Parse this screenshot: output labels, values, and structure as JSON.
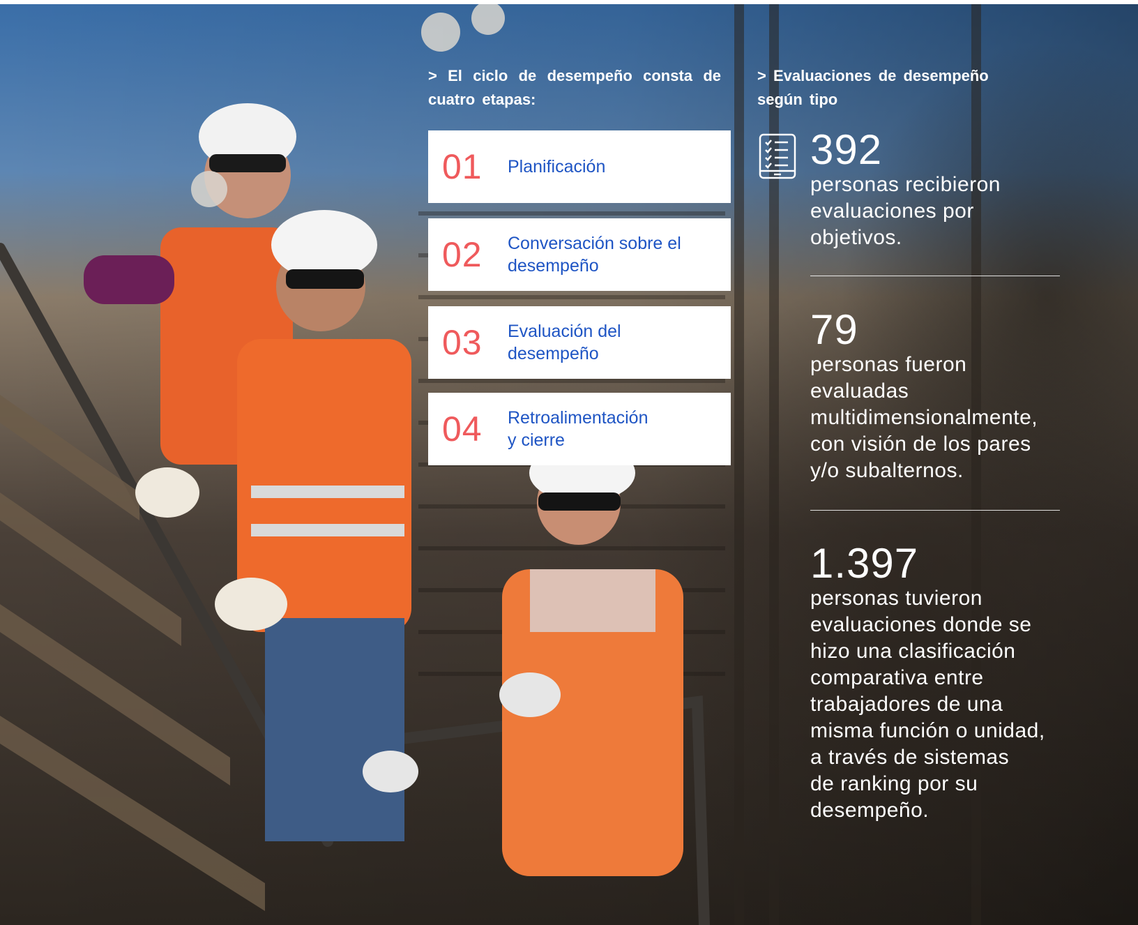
{
  "cycle": {
    "heading": "> El ciclo de desempeño consta de cuatro etapas:",
    "stages": [
      {
        "number": "01",
        "label": "Planificación"
      },
      {
        "number": "02",
        "label": "Conversación sobre el\ndesempeño"
      },
      {
        "number": "03",
        "label": "Evaluación del\ndesempeño"
      },
      {
        "number": "04",
        "label": "Retroalimentación\ny cierre"
      }
    ]
  },
  "evaluations": {
    "heading": "> Evaluaciones de desempeño según tipo",
    "icon": "checklist-tablet-icon",
    "stats": [
      {
        "value": "392",
        "text": "personas recibieron\nevaluaciones por\nobjetivos."
      },
      {
        "value": "79",
        "text": "personas fueron\nevaluadas\nmultidimensionalmente,\ncon visión de los pares\ny/o subalternos."
      },
      {
        "value": "1.397",
        "text": "personas tuvieron\nevaluaciones donde se\nhizo una clasificación\ncomparativa entre\ntrabajadores de una\nmisma función o unidad,\na través de sistemas\nde ranking por su\ndesempeño."
      }
    ]
  },
  "colors": {
    "accent_number": "#ef5a5c",
    "stage_label": "#1f55c4",
    "card_background": "#ffffff",
    "text_on_photo": "#ffffff"
  }
}
